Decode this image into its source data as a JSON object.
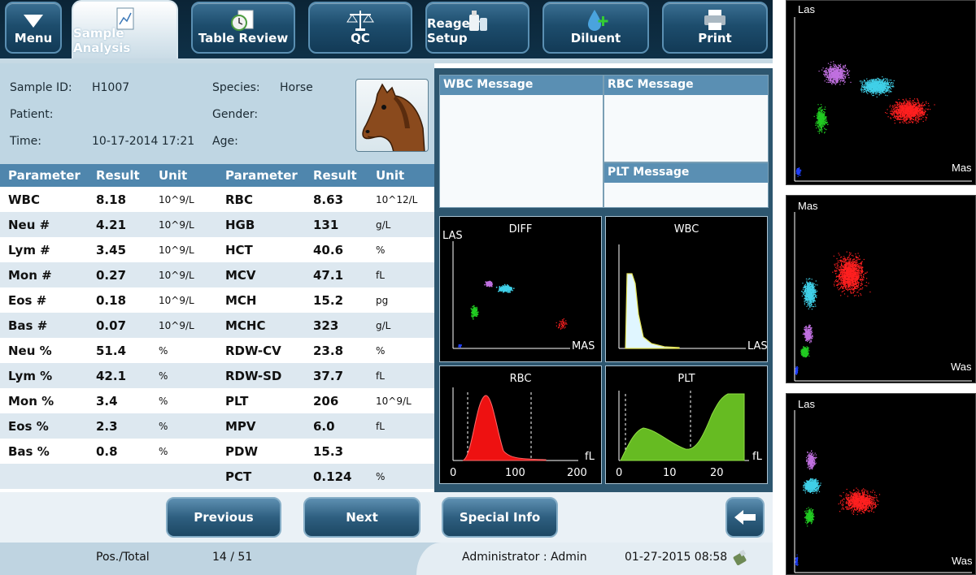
{
  "toolbar": {
    "menu": "Menu",
    "sample_analysis": "Sample Analysis",
    "table_review": "Table Review",
    "qc": "QC",
    "reagent_setup": "Reagent Setup",
    "diluent": "Diluent",
    "print": "Print"
  },
  "sample": {
    "id_label": "Sample ID:",
    "id": "H1007",
    "patient_label": "Patient:",
    "patient": "",
    "time_label": "Time:",
    "time": "10-17-2014 17:21",
    "species_label": "Species:",
    "species": "Horse",
    "gender_label": "Gender:",
    "gender": "",
    "age_label": "Age:",
    "age": ""
  },
  "table": {
    "headers": [
      "Parameter",
      "Result",
      "Unit",
      "Parameter",
      "Result",
      "Unit"
    ],
    "rows": [
      [
        "WBC",
        "8.18",
        "10^9/L",
        "RBC",
        "8.63",
        "10^12/L"
      ],
      [
        "Neu #",
        "4.21",
        "10^9/L",
        "HGB",
        "131",
        "g/L"
      ],
      [
        "Lym #",
        "3.45",
        "10^9/L",
        "HCT",
        "40.6",
        "%"
      ],
      [
        "Mon #",
        "0.27",
        "10^9/L",
        "MCV",
        "47.1",
        "fL"
      ],
      [
        "Eos #",
        "0.18",
        "10^9/L",
        "MCH",
        "15.2",
        "pg"
      ],
      [
        "Bas #",
        "0.07",
        "10^9/L",
        "MCHC",
        "323",
        "g/L"
      ],
      [
        "Neu %",
        "51.4",
        "%",
        "RDW-CV",
        "23.8",
        "%"
      ],
      [
        "Lym %",
        "42.1",
        "%",
        "RDW-SD",
        "37.7",
        "fL"
      ],
      [
        "Mon %",
        "3.4",
        "%",
        "PLT",
        "206",
        "10^9/L"
      ],
      [
        "Eos %",
        "2.3",
        "%",
        "MPV",
        "6.0",
        "fL"
      ],
      [
        "Bas %",
        "0.8",
        "%",
        "PDW",
        "15.3",
        ""
      ],
      [
        "",
        "",
        "",
        "PCT",
        "0.124",
        "%"
      ]
    ]
  },
  "messages": {
    "wbc": "WBC Message",
    "rbc": "RBC Message",
    "plt": "PLT Message"
  },
  "graphs": {
    "diff": {
      "title": "DIFF",
      "ylabel": "LAS",
      "xlabel": "MAS"
    },
    "wbc": {
      "title": "WBC",
      "xlabel": "LAS"
    },
    "rbc": {
      "title": "RBC",
      "unit": "fL",
      "ticks": [
        "0",
        "100",
        "200"
      ]
    },
    "plt": {
      "title": "PLT",
      "unit": "fL",
      "ticks": [
        "0",
        "10",
        "20"
      ]
    }
  },
  "nav": {
    "previous": "Previous",
    "next": "Next",
    "special_info": "Special Info"
  },
  "status": {
    "pos_label": "Pos./Total",
    "pos_value": "14 / 51",
    "user": "Administrator : Admin",
    "datetime": "01-27-2015 08:58"
  },
  "thumbnails": [
    {
      "ylabel": "Las",
      "xlabel": "Mas"
    },
    {
      "ylabel": "Mas",
      "xlabel": "Was"
    },
    {
      "ylabel": "Las",
      "xlabel": "Was"
    }
  ],
  "colors": {
    "header_blue": "#4f86ad",
    "neu": "#ff2020",
    "lym": "#22cc22",
    "mon": "#c070e0",
    "eos": "#40d0e8",
    "bas": "#2040ff",
    "rbc_fill": "#ee1111",
    "plt_fill": "#66bb22",
    "wbc_fill": "#e0f6ff"
  }
}
